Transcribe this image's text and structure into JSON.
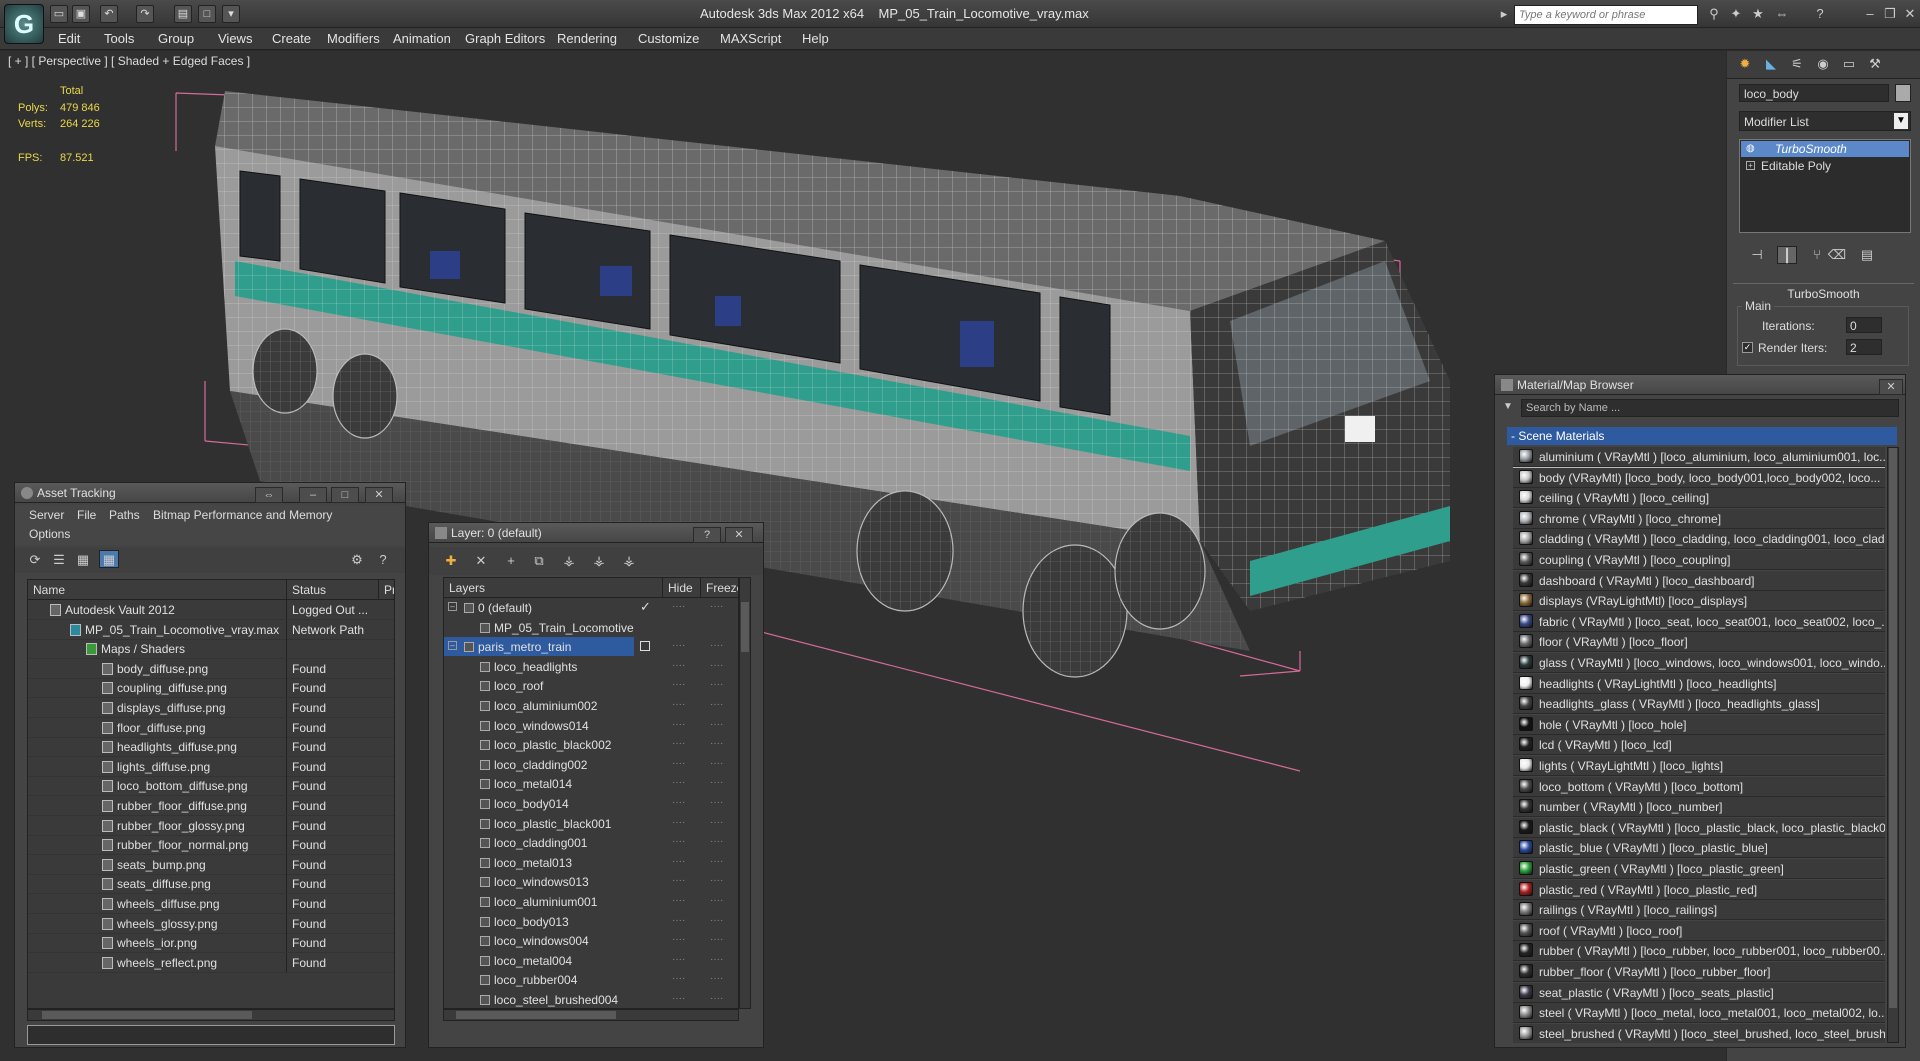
{
  "app": {
    "title": "Autodesk 3ds Max  2012 x64",
    "file": "MP_05_Train_Locomotive_vray.max",
    "search_placeholder": "Type a keyword or phrase",
    "logo_letter": "G"
  },
  "menu": [
    "Edit",
    "Tools",
    "Group",
    "Views",
    "Create",
    "Modifiers",
    "Animation",
    "Graph Editors",
    "Rendering",
    "Customize",
    "MAXScript",
    "Help"
  ],
  "viewport": {
    "label": "[ + ] [ Perspective ] [ Shaded + Edged Faces ]",
    "total_label": "Total",
    "polys_label": "Polys:",
    "polys": "479 846",
    "verts_label": "Verts:",
    "verts": "264 226",
    "fps_label": "FPS:",
    "fps": "87.521"
  },
  "command_panel": {
    "object_name": "loco_body",
    "modifier_list": "Modifier List",
    "stack": [
      "TurboSmooth",
      "Editable Poly"
    ],
    "rollout": "TurboSmooth",
    "group": "Main",
    "iterations_label": "Iterations:",
    "iterations": "0",
    "render_iters_label": "Render Iters:",
    "render_iters": "2"
  },
  "asset_tracking": {
    "title": "Asset Tracking",
    "menu": [
      "Server",
      "File",
      "Paths",
      "Bitmap Performance and Memory",
      "Options"
    ],
    "columns": [
      "Name",
      "Status",
      "Pro"
    ],
    "rows": [
      {
        "name": "Autodesk Vault 2012",
        "status": "Logged Out ..."
      },
      {
        "name": "MP_05_Train_Locomotive_vray.max",
        "status": "Network Path"
      },
      {
        "name": "Maps / Shaders",
        "status": ""
      },
      {
        "name": "body_diffuse.png",
        "status": "Found"
      },
      {
        "name": "coupling_diffuse.png",
        "status": "Found"
      },
      {
        "name": "displays_diffuse.png",
        "status": "Found"
      },
      {
        "name": "floor_diffuse.png",
        "status": "Found"
      },
      {
        "name": "headlights_diffuse.png",
        "status": "Found"
      },
      {
        "name": "lights_diffuse.png",
        "status": "Found"
      },
      {
        "name": "loco_bottom_diffuse.png",
        "status": "Found"
      },
      {
        "name": "rubber_floor_diffuse.png",
        "status": "Found"
      },
      {
        "name": "rubber_floor_glossy.png",
        "status": "Found"
      },
      {
        "name": "rubber_floor_normal.png",
        "status": "Found"
      },
      {
        "name": "seats_bump.png",
        "status": "Found"
      },
      {
        "name": "seats_diffuse.png",
        "status": "Found"
      },
      {
        "name": "wheels_diffuse.png",
        "status": "Found"
      },
      {
        "name": "wheels_glossy.png",
        "status": "Found"
      },
      {
        "name": "wheels_ior.png",
        "status": "Found"
      },
      {
        "name": "wheels_reflect.png",
        "status": "Found"
      }
    ]
  },
  "layers": {
    "title": "Layer: 0 (default)",
    "columns": [
      "Layers",
      "Hide",
      "Freeze"
    ],
    "rows": [
      "0 (default)",
      "MP_05_Train_Locomotive",
      "paris_metro_train",
      "loco_headlights",
      "loco_roof",
      "loco_aluminium002",
      "loco_windows014",
      "loco_plastic_black002",
      "loco_cladding002",
      "loco_metal014",
      "loco_body014",
      "loco_plastic_black001",
      "loco_cladding001",
      "loco_metal013",
      "loco_windows013",
      "loco_aluminium001",
      "loco_body013",
      "loco_windows004",
      "loco_metal004",
      "loco_rubber004",
      "loco_steel_brushed004"
    ],
    "help_label": "?",
    "close_label": "✕"
  },
  "material_browser": {
    "title": "Material/Map Browser",
    "search_placeholder": "Search by Name ...",
    "group": "- Scene Materials",
    "items": [
      {
        "label": "aluminium  ( VRayMtl )  [loco_aluminium, loco_aluminium001, loc...",
        "color": "#9aa0a6"
      },
      {
        "label": "body (VRayMtl) [loco_body, loco_body001,loco_body002, loco...",
        "color": "#c8c8c8"
      },
      {
        "label": "ceiling  ( VRayMtl )  [loco_ceiling]",
        "color": "#d8d8d8"
      },
      {
        "label": "chrome  ( VRayMtl )  [loco_chrome]",
        "color": "#b0b4b8"
      },
      {
        "label": "cladding  ( VRayMtl )  [loco_cladding, loco_cladding001, loco_clad...",
        "color": "#a8a8a8"
      },
      {
        "label": "coupling  ( VRayMtl )  [loco_coupling]",
        "color": "#5a5a5a"
      },
      {
        "label": "dashboard  ( VRayMtl )  [loco_dashboard]",
        "color": "#3a3a3a"
      },
      {
        "label": "displays  (VRayLightMtl)  [loco_displays]",
        "color": "#8a6a3a"
      },
      {
        "label": "fabric  ( VRayMtl )  [loco_seat, loco_seat001, loco_seat002, loco_...",
        "color": "#3a4a8a"
      },
      {
        "label": "floor  ( VRayMtl )  [loco_floor]",
        "color": "#6a6a6a"
      },
      {
        "label": "glass  ( VRayMtl )  [loco_windows, loco_windows001, loco_windo...",
        "color": "#2a3a3a"
      },
      {
        "label": "headlights  ( VRayLightMtl )  [loco_headlights]",
        "color": "#f0f0f0"
      },
      {
        "label": "headlights_glass  ( VRayMtl )  [loco_headlights_glass]",
        "color": "#444"
      },
      {
        "label": "hole  ( VRayMtl )  [loco_hole]",
        "color": "#111"
      },
      {
        "label": "lcd  ( VRayMtl )  [loco_lcd]",
        "color": "#222"
      },
      {
        "label": "lights  ( VRayLightMtl )  [loco_lights]",
        "color": "#e8e8e8"
      },
      {
        "label": "loco_bottom  ( VRayMtl )  [loco_bottom]",
        "color": "#4a4a4a"
      },
      {
        "label": "number  ( VRayMtl )  [loco_number]",
        "color": "#333"
      },
      {
        "label": "plastic_black  ( VRayMtl )  [loco_plastic_black, loco_plastic_black0...",
        "color": "#1a1a1a"
      },
      {
        "label": "plastic_blue  ( VRayMtl )  [loco_plastic_blue]",
        "color": "#2a4aa0"
      },
      {
        "label": "plastic_green  ( VRayMtl )  [loco_plastic_green]",
        "color": "#2aa03a"
      },
      {
        "label": "plastic_red  ( VRayMtl )  [loco_plastic_red]",
        "color": "#b02020"
      },
      {
        "label": "railings  ( VRayMtl )  [loco_railings]",
        "color": "#7a7a7a"
      },
      {
        "label": "roof  ( VRayMtl )  [loco_roof]",
        "color": "#555"
      },
      {
        "label": "rubber  ( VRayMtl )  [loco_rubber, loco_rubber001, loco_rubber00...",
        "color": "#252525"
      },
      {
        "label": "rubber_floor  ( VRayMtl )  [loco_rubber_floor]",
        "color": "#303030"
      },
      {
        "label": "seat_plastic  ( VRayMtl )  [loco_seats_plastic]",
        "color": "#3a3a4a"
      },
      {
        "label": "steel  ( VRayMtl )  [loco_metal, loco_metal001, loco_metal002, lo...",
        "color": "#8a8a8a"
      },
      {
        "label": "steel_brushed  ( VRayMtl )  [loco_steel_brushed, loco_steel_brush...",
        "color": "#9a9a9a"
      }
    ]
  }
}
